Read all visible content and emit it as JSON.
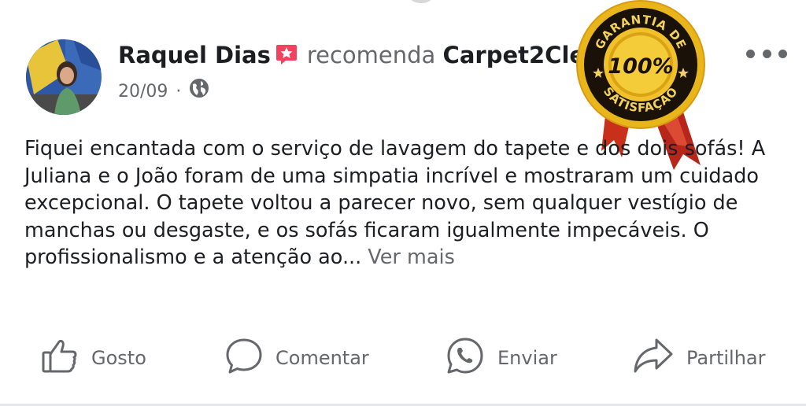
{
  "post": {
    "author": "Raquel Dias",
    "recommend_word": "recomenda",
    "page_name": "Carpet2Clean",
    "page_name_suffix": ".",
    "date": "20/09",
    "separator": "·",
    "audience_icon": "globe-icon",
    "body": "Fiquei encantada com o serviço de lavagem do tapete e dos dois sofás! A Juliana e o João foram de uma simpatia incrível e mostraram um cuidado excepcional. O tapete voltou a parecer novo, sem qualquer vestígio de manchas ou desgaste, e os sofás ficaram igualmente impecáveis. O profissionalismo e a atenção ao...",
    "see_more": "Ver mais"
  },
  "seal": {
    "top_text": "GARANTIA DE",
    "center_text": "100%",
    "bottom_text": "SATISFAÇÃO",
    "colors": {
      "gold": "#e8b51a",
      "dark": "#1a1208",
      "ribbon": "#c9301c"
    }
  },
  "actions": [
    {
      "label": "Gosto",
      "icon": "thumbs-up-icon"
    },
    {
      "label": "Comentar",
      "icon": "comment-icon"
    },
    {
      "label": "Enviar",
      "icon": "whatsapp-icon"
    },
    {
      "label": "Partilhar",
      "icon": "share-icon"
    }
  ],
  "colors": {
    "text": "#1c1e21",
    "secondary": "#65676b",
    "recommend_badge": "#f3425f"
  }
}
